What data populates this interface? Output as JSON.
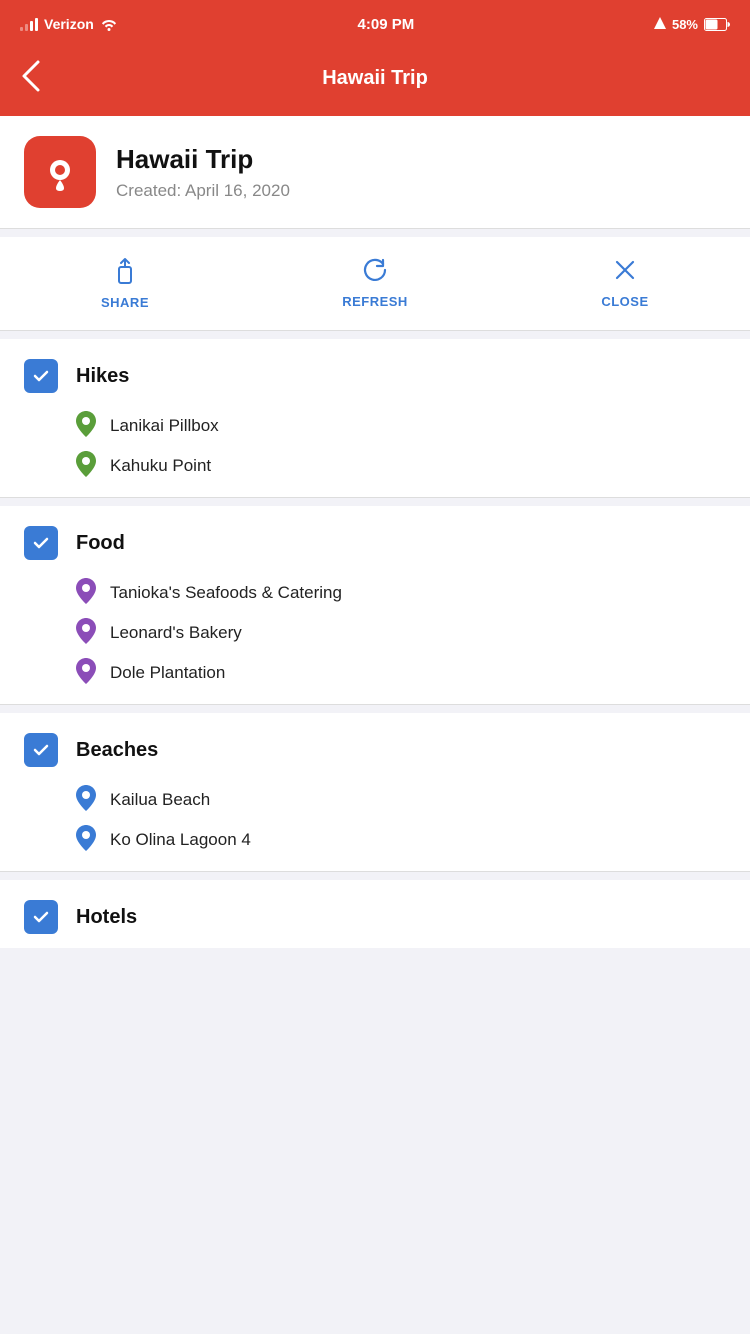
{
  "status_bar": {
    "carrier": "Verizon",
    "time": "4:09 PM",
    "battery": "58%"
  },
  "nav": {
    "back_label": "‹",
    "title": "Hawaii Trip"
  },
  "trip": {
    "name": "Hawaii Trip",
    "created": "Created: April 16, 2020"
  },
  "actions": [
    {
      "id": "share",
      "label": "SHARE"
    },
    {
      "id": "refresh",
      "label": "REFRESH"
    },
    {
      "id": "close",
      "label": "CLOSE"
    }
  ],
  "sections": [
    {
      "id": "hikes",
      "title": "Hikes",
      "checked": true,
      "pin_color": "green",
      "items": [
        {
          "name": "Lanikai Pillbox"
        },
        {
          "name": "Kahuku Point"
        }
      ]
    },
    {
      "id": "food",
      "title": "Food",
      "checked": true,
      "pin_color": "purple",
      "items": [
        {
          "name": "Tanioka's Seafoods & Catering"
        },
        {
          "name": "Leonard's Bakery"
        },
        {
          "name": "Dole Plantation"
        }
      ]
    },
    {
      "id": "beaches",
      "title": "Beaches",
      "checked": true,
      "pin_color": "blue",
      "items": [
        {
          "name": "Kailua Beach"
        },
        {
          "name": "Ko Olina Lagoon 4"
        }
      ]
    },
    {
      "id": "hotels",
      "title": "Hotels",
      "checked": true,
      "pin_color": "blue",
      "items": []
    }
  ]
}
